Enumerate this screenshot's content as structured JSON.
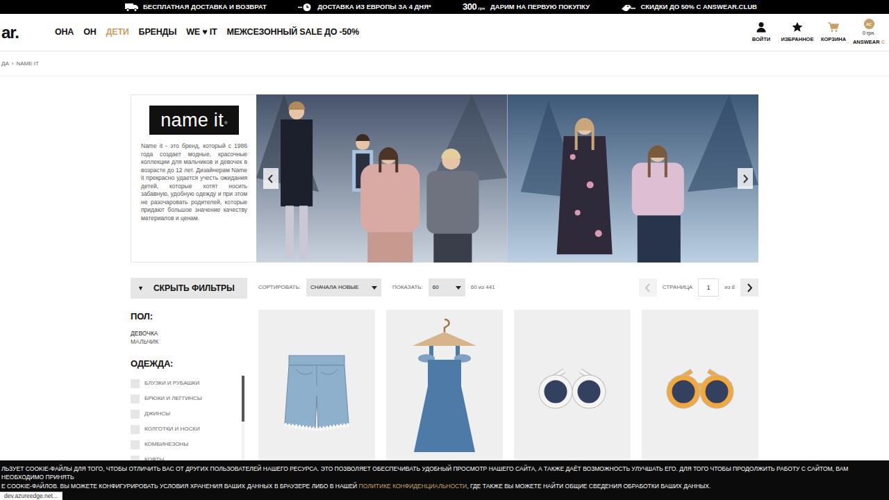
{
  "promo_bar": [
    {
      "text": "БЕСПЛАТНАЯ ДОСТАВКА И ВОЗВРАТ"
    },
    {
      "text": "ДОСТАВКА ИЗ ЕВРОПЫ ЗА 4 ДНЯ*"
    },
    {
      "amount": "300",
      "unit": "грн",
      "text": "ДАРИМ НА ПЕРВУЮ ПОКУПКУ"
    },
    {
      "text": "СКИДКИ ДО 50% С ANSWEAR.CLUB"
    }
  ],
  "header": {
    "logo": "ar.",
    "nav": [
      {
        "label": "ОНА",
        "selected": false
      },
      {
        "label": "ОН",
        "selected": false
      },
      {
        "label": "ДЕТИ",
        "selected": true
      },
      {
        "label": "БРЕНДЫ",
        "selected": false
      },
      {
        "label": "WE ♥ IT",
        "selected": false
      },
      {
        "label": "МЕЖСЕЗОННЫЙ SALE ДО -50%",
        "selected": false
      }
    ],
    "account": [
      {
        "label": "ВОЙТИ"
      },
      {
        "label": "ИЗБРАННОЕ"
      },
      {
        "label": "КОРЗИНА"
      }
    ],
    "club": {
      "badge": "AC",
      "total": "0 грн.",
      "label": "ANSWEAR",
      "label_tail": "C"
    }
  },
  "breadcrumb": {
    "items": [
      "ДА",
      "NAME IT"
    ],
    "separator": "›"
  },
  "brand": {
    "logo": "name it",
    "logo_mark": "®",
    "description": "Name it - это бренд, который с 1986 года создает модные, красочные коллекции для мальчиков и девочек в возрасте до 12 лет. Дизайнерам Name it прекрасно удается учесть ожидания детей, которые хотят носить забавную, удобную одежду и при этом не разочаровать родителей, которые придают большое значение качеству материалов и ценам."
  },
  "filters": {
    "toggle_icon": "▼",
    "toggle_label": "СКРЫТЬ ФИЛЬТРЫ",
    "gender": {
      "title": "ПОЛ:",
      "options": [
        "ДЕВОЧКА",
        "МАЛЬЧИК"
      ]
    },
    "clothing": {
      "title": "ОДЕЖДА:",
      "options": [
        {
          "label": "БЛУЗКИ И РУБАШКИ",
          "checked": false
        },
        {
          "label": "БРЮКИ И ЛЕГГИНСЫ",
          "checked": false
        },
        {
          "label": "ДЖИНСЫ",
          "checked": false
        },
        {
          "label": "КОЛГОТКИ И НОСКИ",
          "checked": false
        },
        {
          "label": "КОМБИНЕЗОНЫ",
          "checked": false
        },
        {
          "label": "КОФТЫ",
          "checked": false
        }
      ]
    }
  },
  "toolbar": {
    "sort_label": "СОРТИРОВАТЬ:",
    "sort_value": "СНАЧАЛА НОВЫЕ",
    "show_label": "ПОКАЗАТЬ:",
    "show_value": "60",
    "count": "60 из 441",
    "page_label": "СТРАНИЦА",
    "page_value": "1",
    "page_total": "из 8",
    "prev_disabled": true,
    "next_disabled": false
  },
  "products": [
    {
      "kind": "shorts",
      "color": "#8fb0cc"
    },
    {
      "kind": "dress",
      "color": "#4d7aa6"
    },
    {
      "kind": "sunglasses",
      "color": "#f4f4f4"
    },
    {
      "kind": "sunglasses",
      "color": "#f2a93b"
    }
  ],
  "cookie": {
    "line1": "ЛЬЗУЕТ COOKIE-ФАЙЛЫ ДЛЯ ТОГО, ЧТОБЫ ОТЛИЧИТЬ ВАС ОТ ДРУГИХ ПОЛЬЗОВАТЕЛЕЙ НАШЕГО РЕСУРСА. ЭТО ПОЗВОЛЯЕТ ОБЕСПЕЧИВАТЬ УДОБНЫЙ ПРОСМОТР НАШЕГО САЙТА, А ТАКЖЕ ДАЁТ ВОЗМОЖНОСТЬ УЛУЧШАТЬ ЕГО. ДЛЯ ТОГО ЧТОБЫ ПРОДОЛЖИТЬ РАБОТУ С САЙТОМ, ВАМ НЕОБХОДИМО ПРИНЯТЬ",
    "line2_before": "Е COOKIE-ФАЙЛОВ. ВЫ МОЖЕТЕ КОНФИГУРИРОВАТЬ УСЛОВИЯ ХРАНЕНИЯ ВАШИХ ДАННЫХ В БРАУЗЕРЕ ЛИБО В НАШЕЙ ",
    "link": "ПОЛИТИКЕ КОНФИДЕНЦИАЛЬНОСТИ",
    "line2_after": ", ГДЕ ТАКЖЕ ВЫ МОЖЕТЕ НАЙТИ ОБЩИЕ СВЕДЕНИЯ ОБРАБОТКИ ВАШИХ ДАННЫХ."
  },
  "status_url": "dev.azureedge.net..."
}
